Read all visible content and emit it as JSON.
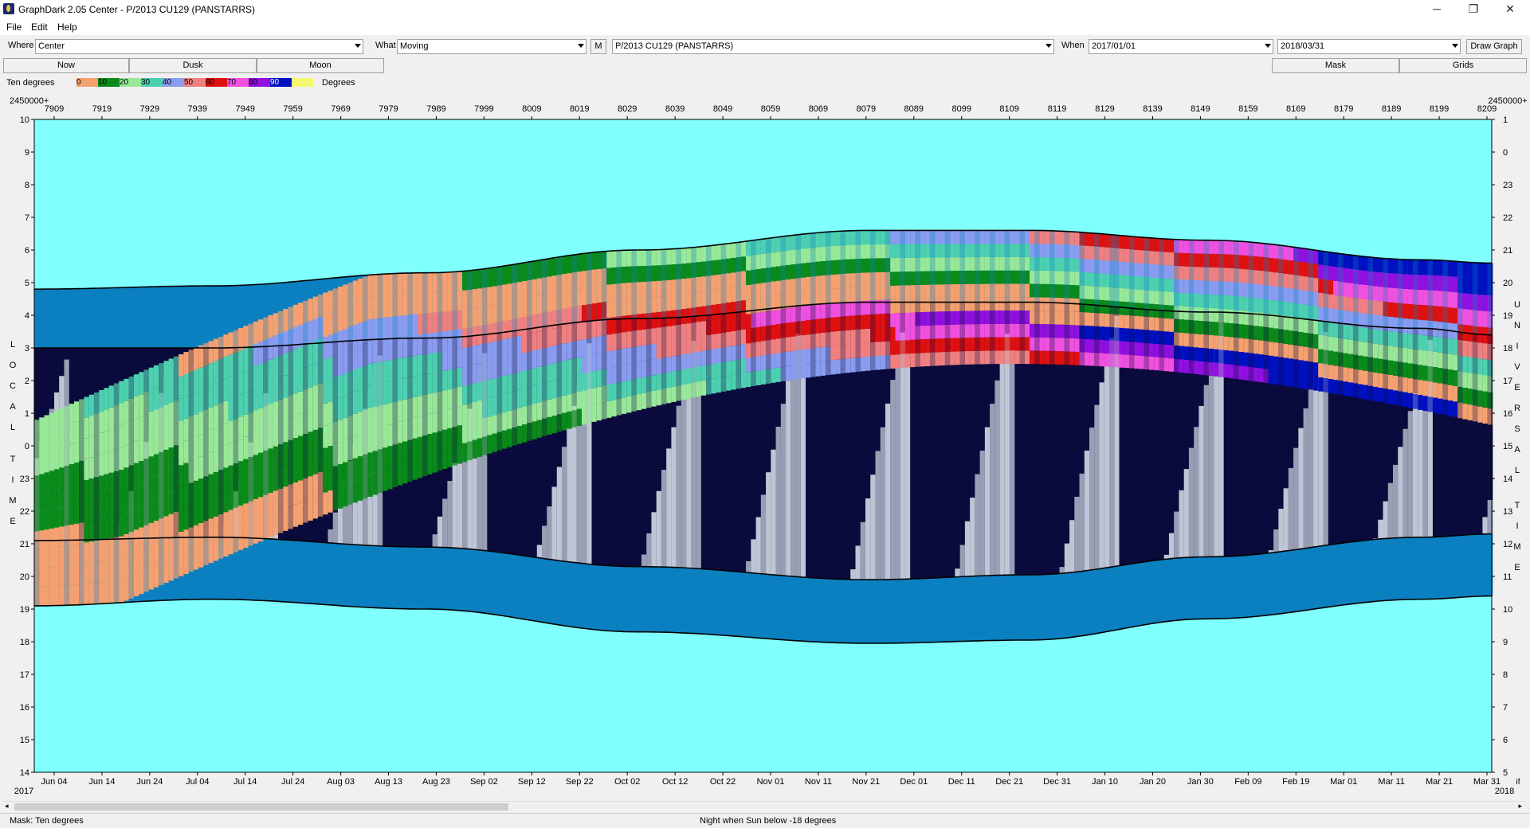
{
  "window": {
    "title": "GraphDark 2.05  Center  -  P/2013 CU129 (PANSTARRS)",
    "minimize": "─",
    "restore": "❐",
    "close": "✕"
  },
  "menu": {
    "file": "File",
    "edit": "Edit",
    "help": "Help"
  },
  "toolbar": {
    "where_label": "Where",
    "where_value": "Center",
    "what_label": "What",
    "what_value": "Moving",
    "m_button": "M",
    "object_value": "P/2013 CU129 (PANSTARRS)",
    "when_label": "When",
    "start_date": "2017/01/01",
    "end_date": "2018/03/31",
    "draw_button": "Draw Graph"
  },
  "tabs": {
    "now": "Now",
    "dusk": "Dusk",
    "moon": "Moon",
    "mask": "Mask",
    "grids": "Grids"
  },
  "legend": {
    "left_label": "Ten degrees",
    "right_label": "Degrees",
    "scale": [
      {
        "label": "0",
        "color": "#f4a070"
      },
      {
        "label": "10",
        "color": "#0a8a1a"
      },
      {
        "label": "20",
        "color": "#98e898"
      },
      {
        "label": "30",
        "color": "#4dd0b0"
      },
      {
        "label": "40",
        "color": "#8a9cf0"
      },
      {
        "label": "50",
        "color": "#f08080"
      },
      {
        "label": "60",
        "color": "#e01010"
      },
      {
        "label": "70",
        "color": "#f050e0"
      },
      {
        "label": "80",
        "color": "#9010e0"
      },
      {
        "label": "90",
        "color": "#0010c0"
      },
      {
        "label": "",
        "color": "#f8f870"
      }
    ]
  },
  "chart_data": {
    "type": "area",
    "title": "",
    "top_axis_prefix_left": "2450000+",
    "top_axis_prefix_right": "2450000+",
    "jd_ticks": [
      "7909",
      "7919",
      "7929",
      "7939",
      "7949",
      "7959",
      "7969",
      "7979",
      "7989",
      "7999",
      "8009",
      "8019",
      "8029",
      "8039",
      "8049",
      "8059",
      "8069",
      "8079",
      "8089",
      "8099",
      "8109",
      "8119",
      "8129",
      "8139",
      "8149",
      "8159",
      "8169",
      "8179",
      "8189",
      "8199",
      "8209"
    ],
    "date_ticks": [
      "Jun 04",
      "Jun 14",
      "Jun 24",
      "Jul 04",
      "Jul 14",
      "Jul 24",
      "Aug 03",
      "Aug 13",
      "Aug 23",
      "Sep 02",
      "Sep 12",
      "Sep 22",
      "Oct 02",
      "Oct 12",
      "Oct 22",
      "Nov 01",
      "Nov 11",
      "Nov 21",
      "Dec 01",
      "Dec 11",
      "Dec 21",
      "Dec 31",
      "Jan 10",
      "Jan 20",
      "Jan 30",
      "Feb 09",
      "Feb 19",
      "Mar 01",
      "Mar 11",
      "Mar 21",
      "Mar 31"
    ],
    "year_left": "2017",
    "year_right": "2018",
    "right_bottom_mark": "if",
    "left_axis_title": "LOCAL TIME",
    "right_axis_title": "UNIVERSAL TIME",
    "left_ticks": [
      "10",
      "9",
      "8",
      "7",
      "6",
      "5",
      "4",
      "3",
      "2",
      "1",
      "0",
      "23",
      "22",
      "21",
      "20",
      "19",
      "18",
      "17",
      "16",
      "15",
      "14"
    ],
    "right_ticks": [
      "1",
      "0",
      "23",
      "22",
      "21",
      "20",
      "19",
      "18",
      "17",
      "16",
      "15",
      "14",
      "13",
      "12",
      "11",
      "10",
      "9",
      "8",
      "7",
      "6",
      "5"
    ],
    "background_color": "#80ffff",
    "night_color": "#0a0a3c",
    "twilight_color": "#0a80c0",
    "moon_color": "#c8d0dc",
    "x_range_jd": [
      2457905,
      2458209
    ],
    "y_range_local_hours": [
      14,
      34
    ],
    "dusk_local": [
      [
        0,
        19.1
      ],
      [
        50,
        19.3
      ],
      [
        110,
        19.0
      ],
      [
        170,
        18.3
      ],
      [
        235,
        17.95
      ],
      [
        280,
        18.05
      ],
      [
        330,
        18.7
      ],
      [
        390,
        19.3
      ],
      [
        410,
        19.4
      ]
    ],
    "night_start_local": [
      [
        0,
        21.1
      ],
      [
        50,
        21.2
      ],
      [
        110,
        20.9
      ],
      [
        170,
        20.3
      ],
      [
        235,
        19.9
      ],
      [
        280,
        20.05
      ],
      [
        330,
        20.6
      ],
      [
        390,
        21.2
      ],
      [
        410,
        21.3
      ]
    ],
    "night_end_local": [
      [
        0,
        27.0
      ],
      [
        50,
        27.0
      ],
      [
        110,
        27.3
      ],
      [
        170,
        27.9
      ],
      [
        235,
        28.4
      ],
      [
        280,
        28.4
      ],
      [
        330,
        28.1
      ],
      [
        390,
        27.6
      ],
      [
        410,
        27.4
      ]
    ],
    "dawn_local": [
      [
        0,
        28.8
      ],
      [
        50,
        28.9
      ],
      [
        110,
        29.3
      ],
      [
        170,
        30.0
      ],
      [
        235,
        30.6
      ],
      [
        280,
        30.6
      ],
      [
        330,
        30.3
      ],
      [
        390,
        29.7
      ],
      [
        410,
        29.6
      ]
    ]
  },
  "status": {
    "mask": "Mask:  Ten degrees",
    "night": "Night when Sun below -18 degrees"
  }
}
